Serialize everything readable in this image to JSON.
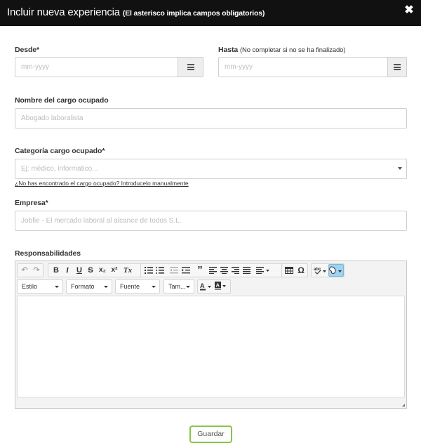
{
  "dialog": {
    "title": "Incluir nueva experiencia",
    "subtitle": "(El asterisco implica campos obligatorios)"
  },
  "fields": {
    "desde": {
      "label": "Desde",
      "required_mark": "*",
      "placeholder": "mm-yyyy"
    },
    "hasta": {
      "label": "Hasta",
      "hint": "(No completar si no se ha finalizado)",
      "placeholder": "mm-yyyy"
    },
    "cargo": {
      "label": "Nombre del cargo ocupado",
      "placeholder": "Abogado laboralista"
    },
    "categoria": {
      "label": "Categoría cargo ocupado",
      "required_mark": "*",
      "placeholder": "Ej: médico, informatico...",
      "manual_link": "¿No has encontrado el cargo ocupado? Introducelo manualmente"
    },
    "empresa": {
      "label": "Empresa",
      "required_mark": "*",
      "placeholder": "Jobfie - El mercado laboral al alcance de todos S.L."
    },
    "responsabilidades": {
      "label": "Responsabilidades"
    }
  },
  "editor": {
    "buttons": {
      "undo": "↶",
      "redo": "↷",
      "bold": "B",
      "italic": "I",
      "underline": "U",
      "strike": "S",
      "subscript": "x₂",
      "superscript": "x²",
      "remove_format": "Tx",
      "quote": "”",
      "omega": "Ω"
    },
    "combos": {
      "estilo": "Estilo",
      "formato": "Formato",
      "fuente": "Fuente",
      "tamano": "Tam..."
    }
  },
  "actions": {
    "save": "Guardar"
  }
}
